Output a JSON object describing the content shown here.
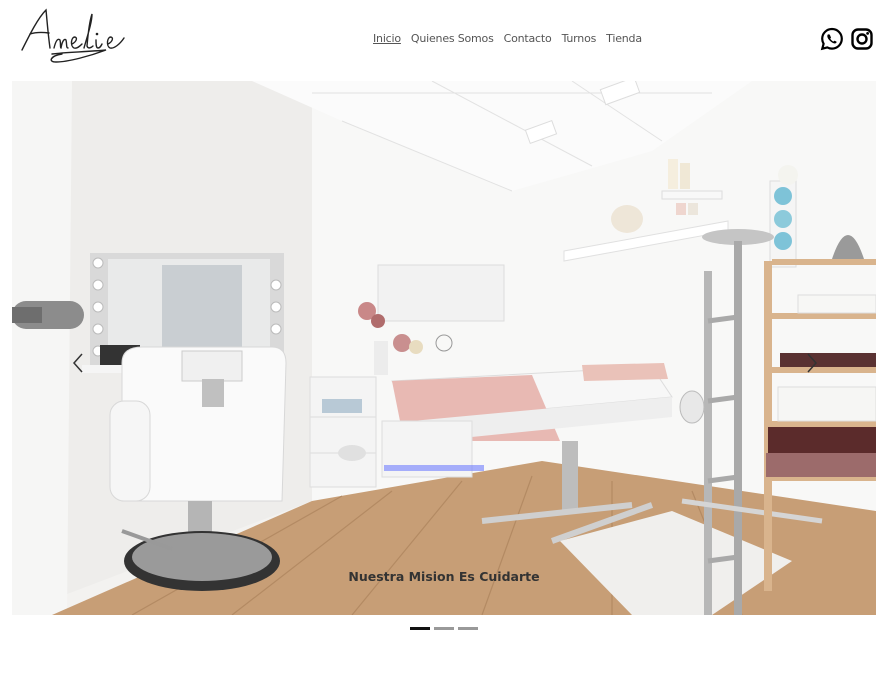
{
  "brand": {
    "logo_text": "Amelie"
  },
  "nav": {
    "items": [
      {
        "label": "Inicio",
        "active": true
      },
      {
        "label": "Quienes Somos",
        "active": false
      },
      {
        "label": "Contacto",
        "active": false
      },
      {
        "label": "Turnos",
        "active": false
      },
      {
        "label": "Tienda",
        "active": false
      }
    ]
  },
  "social": {
    "icons": [
      "whatsapp-icon",
      "instagram-icon"
    ]
  },
  "carousel": {
    "caption": "Nuestra Mision Es Cuidarte",
    "slide_count": 3,
    "active_index": 0,
    "prev_icon": "chevron-left-icon",
    "next_icon": "chevron-right-icon"
  },
  "colors": {
    "text": "#555555",
    "caption": "#333333",
    "indicator_active": "#111111",
    "indicator_inactive": "#999999"
  }
}
